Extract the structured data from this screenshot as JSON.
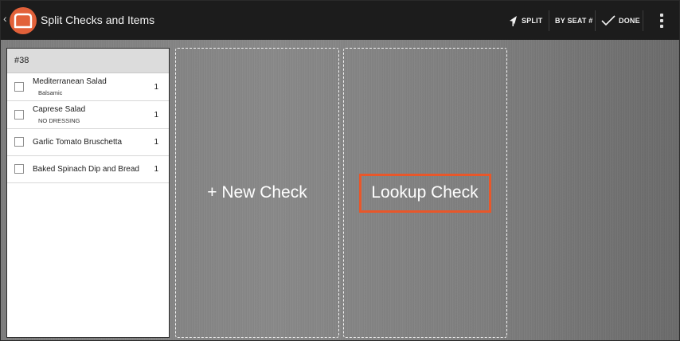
{
  "topbar": {
    "title": "Split Checks and Items",
    "actions": {
      "split": "SPLIT",
      "by_seat": "BY SEAT #",
      "done": "DONE"
    }
  },
  "check": {
    "number": "#38",
    "items": [
      {
        "name": "Mediterranean Salad",
        "modifier": "Balsamic",
        "qty": "1"
      },
      {
        "name": "Caprese Salad",
        "modifier": "NO DRESSING",
        "qty": "1"
      },
      {
        "name": "Garlic Tomato Bruschetta",
        "modifier": "",
        "qty": "1"
      },
      {
        "name": "Baked Spinach Dip and Bread",
        "modifier": "",
        "qty": "1"
      }
    ]
  },
  "columns": {
    "new_check": "+ New Check",
    "lookup_check": "Lookup Check"
  },
  "colors": {
    "brand": "#e2613a",
    "highlight": "#e8572a",
    "topbar": "#1c1c1c"
  }
}
